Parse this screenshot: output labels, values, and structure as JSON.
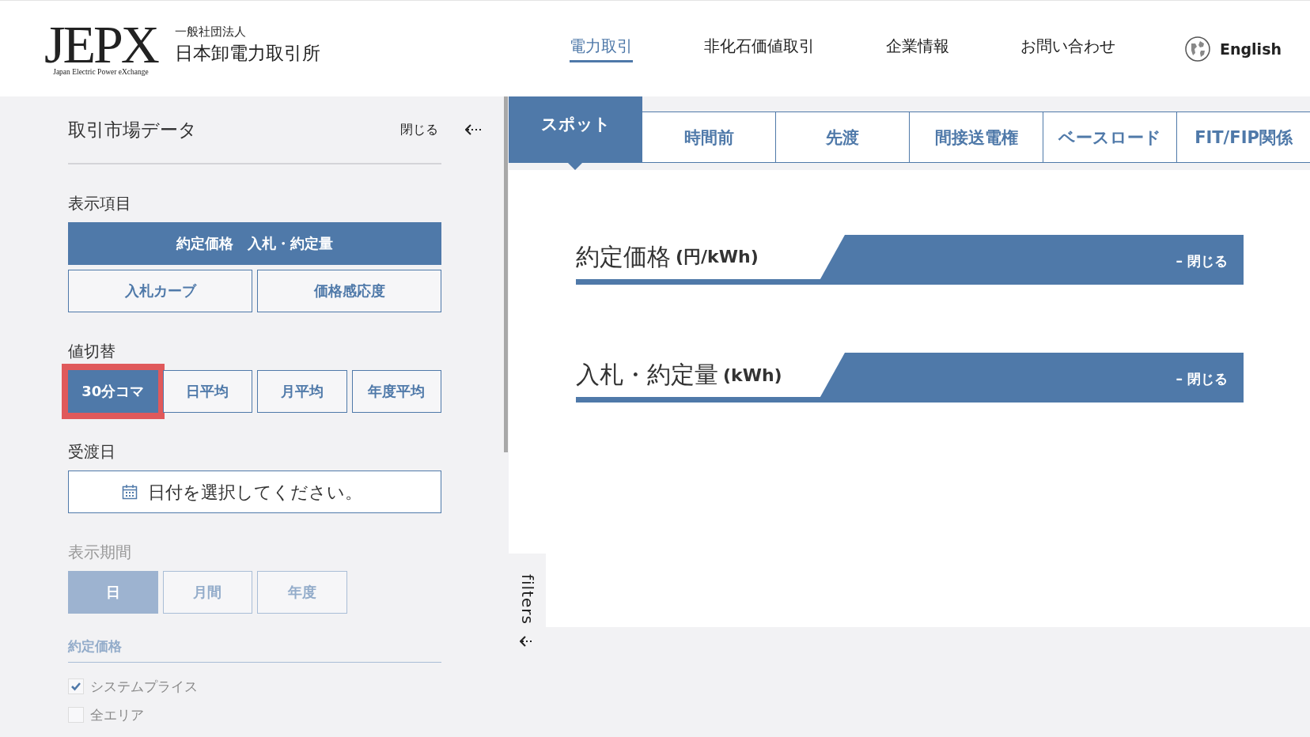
{
  "header": {
    "logo": {
      "mark": "JEPX",
      "tagline": "Japan Electric Power eXchange"
    },
    "org_type": "一般社団法人",
    "org_name": "日本卸電力取引所",
    "nav": [
      {
        "label": "電力取引",
        "selected": true
      },
      {
        "label": "非化石価値取引",
        "selected": false
      },
      {
        "label": "企業情報",
        "selected": false
      },
      {
        "label": "お問い合わせ",
        "selected": false
      }
    ],
    "language": "English"
  },
  "sidebar": {
    "title": "取引市場データ",
    "close_label": "閉じる",
    "display_items": {
      "label": "表示項目",
      "buttons": [
        {
          "label": "約定価格　入札・約定量",
          "selected": true
        },
        {
          "label": "入札カーブ",
          "selected": false
        },
        {
          "label": "価格感応度",
          "selected": false
        }
      ]
    },
    "value_switch": {
      "label": "値切替",
      "buttons": [
        {
          "label": "30分コマ",
          "selected": true,
          "highlighted": true
        },
        {
          "label": "日平均",
          "selected": false,
          "highlighted": false
        },
        {
          "label": "月平均",
          "selected": false,
          "highlighted": false
        },
        {
          "label": "年度平均",
          "selected": false,
          "highlighted": false
        }
      ]
    },
    "delivery_date": {
      "label": "受渡日",
      "placeholder": "日付を選択してください。"
    },
    "display_period": {
      "label": "表示期間",
      "disabled": true,
      "buttons": [
        {
          "label": "日",
          "selected": true
        },
        {
          "label": "月間",
          "selected": false
        },
        {
          "label": "年度",
          "selected": false
        }
      ]
    },
    "price_filter": {
      "label": "約定価格",
      "options": [
        {
          "label": "システムプライス",
          "checked": true
        },
        {
          "label": "全エリア",
          "checked": false
        }
      ]
    }
  },
  "market_tabs": [
    {
      "label": "スポット",
      "selected": true
    },
    {
      "label": "時間前",
      "selected": false
    },
    {
      "label": "先渡",
      "selected": false
    },
    {
      "label": "間接送電権",
      "selected": false
    },
    {
      "label": "ベースロード",
      "selected": false
    },
    {
      "label": "FIT/FIP関係",
      "selected": false
    }
  ],
  "sections": [
    {
      "title": "約定価格",
      "unit": "(円/kWh)",
      "close_label": "– 閉じる"
    },
    {
      "title": "入札・約定量",
      "unit": "(kWh)",
      "close_label": "– 閉じる"
    }
  ],
  "filters_tab": "filters"
}
